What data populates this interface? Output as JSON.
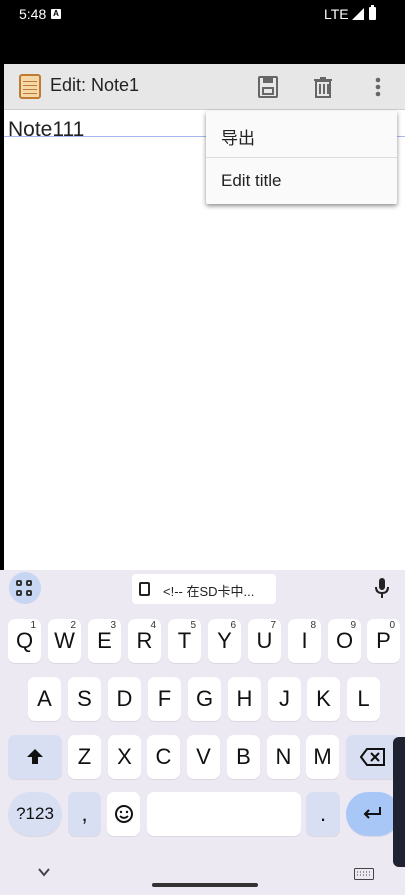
{
  "status_bar": {
    "time": "5:48",
    "indicator": "A",
    "network": "LTE",
    "signal_icon": "signal-icon",
    "battery_icon": "battery-icon"
  },
  "toolbar": {
    "title": "Edit: Note1",
    "app_icon": "notepad-icon",
    "save_icon": "save-icon",
    "delete_icon": "trash-icon",
    "more_icon": "more-vert-icon"
  },
  "editor": {
    "content": "Note111"
  },
  "menu": {
    "items": [
      {
        "label": "导出"
      },
      {
        "label": "Edit title"
      }
    ]
  },
  "keyboard": {
    "suggestion": "<!-- 在SD卡中...",
    "rows": [
      [
        {
          "key": "Q",
          "hint": "1"
        },
        {
          "key": "W",
          "hint": "2"
        },
        {
          "key": "E",
          "hint": "3"
        },
        {
          "key": "R",
          "hint": "4"
        },
        {
          "key": "T",
          "hint": "5"
        },
        {
          "key": "Y",
          "hint": "6"
        },
        {
          "key": "U",
          "hint": "7"
        },
        {
          "key": "I",
          "hint": "8"
        },
        {
          "key": "O",
          "hint": "9"
        },
        {
          "key": "P",
          "hint": "0"
        }
      ],
      [
        {
          "key": "A"
        },
        {
          "key": "S"
        },
        {
          "key": "D"
        },
        {
          "key": "F"
        },
        {
          "key": "G"
        },
        {
          "key": "H"
        },
        {
          "key": "J"
        },
        {
          "key": "K"
        },
        {
          "key": "L"
        }
      ],
      [
        {
          "key": "Z"
        },
        {
          "key": "X"
        },
        {
          "key": "C"
        },
        {
          "key": "V"
        },
        {
          "key": "B"
        },
        {
          "key": "N"
        },
        {
          "key": "M"
        }
      ]
    ],
    "numeric_label": "?123",
    "comma": ",",
    "period": ".",
    "emoji_icon": "emoji-icon",
    "apps_icon": "grid-icon",
    "mic_icon": "mic-icon",
    "shift_icon": "shift-icon",
    "backspace_icon": "backspace-icon",
    "enter_icon": "enter-icon",
    "hide_icon": "chevron-down-icon",
    "keyboard_icon": "keyboard-icon"
  }
}
